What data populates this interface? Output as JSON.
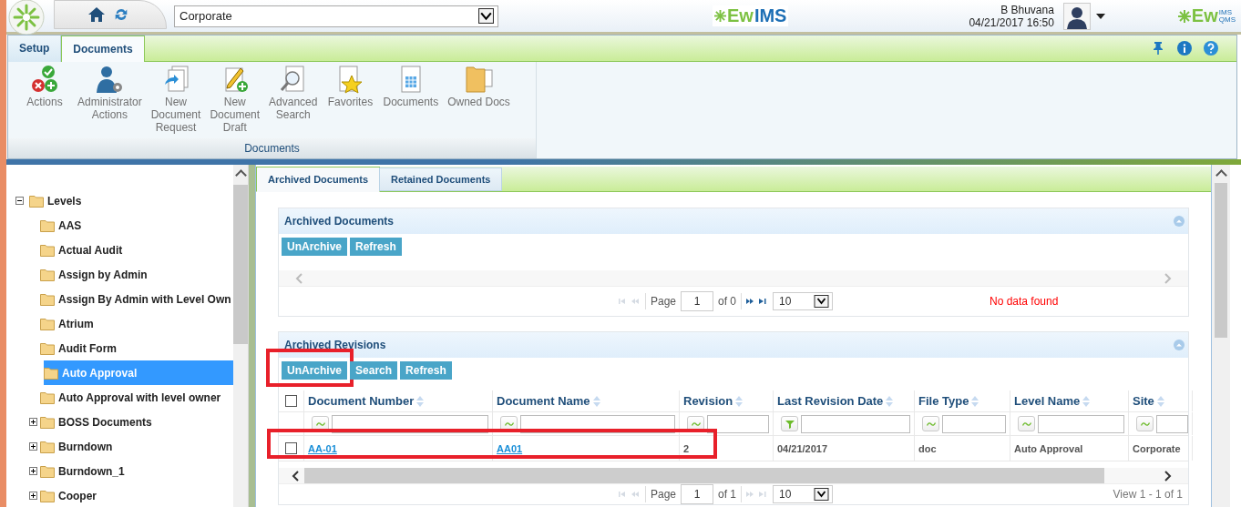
{
  "header": {
    "selector": {
      "value": "Corporate"
    },
    "center_logo": {
      "prefix": "Ew",
      "suffix": "IMS"
    },
    "user": {
      "name": "B Bhuvana",
      "datetime": "04/21/2017 16:50"
    },
    "right_logo": {
      "prefix": "Ew",
      "top": "IMS",
      "bottom": "QMS"
    }
  },
  "ribbon": {
    "tabs": [
      {
        "label": "Setup",
        "selected": false
      },
      {
        "label": "Documents",
        "selected": true
      }
    ],
    "groups": [
      {
        "label": "Documents",
        "items": [
          {
            "kind": "actions",
            "label": "Actions"
          },
          {
            "kind": "admin",
            "label": "Administrator\nActions"
          },
          {
            "kind": "request",
            "label": "New\nDocument\nRequest"
          },
          {
            "kind": "draft",
            "label": "New\nDocument\nDraft"
          },
          {
            "kind": "search",
            "label": "Advanced\nSearch"
          },
          {
            "kind": "favorites",
            "label": "Favorites"
          },
          {
            "kind": "documents",
            "label": "Documents"
          },
          {
            "kind": "owned",
            "label": "Owned Docs"
          }
        ]
      }
    ]
  },
  "tree": {
    "root": {
      "label": "Levels",
      "expanded": true,
      "selected": false,
      "children": [
        {
          "label": "AAS",
          "selected": false
        },
        {
          "label": "Actual Audit",
          "selected": false
        },
        {
          "label": "Assign by Admin",
          "selected": false
        },
        {
          "label": "Assign By Admin with Level Own",
          "selected": false
        },
        {
          "label": "Atrium",
          "selected": false
        },
        {
          "label": "Audit Form",
          "selected": false
        },
        {
          "label": "Auto Approval",
          "selected": true
        },
        {
          "label": "Auto Approval with level owner",
          "selected": false
        },
        {
          "label": "BOSS Documents",
          "selected": false,
          "expanded": false
        },
        {
          "label": "Burndown",
          "selected": false,
          "expanded": false
        },
        {
          "label": "Burndown_1",
          "selected": false,
          "expanded": false
        },
        {
          "label": "Cooper",
          "selected": false,
          "expanded": false
        }
      ]
    }
  },
  "content": {
    "tabs": [
      {
        "label": "Archived Documents",
        "selected": true
      },
      {
        "label": "Retained Documents",
        "selected": false
      }
    ],
    "panels": [
      {
        "title": "Archived Documents",
        "buttons": [
          {
            "label": "UnArchive",
            "highlighted": false
          },
          {
            "label": "Refresh",
            "highlighted": false
          }
        ],
        "pager": {
          "page_label": "Page",
          "page": "1",
          "of": "of 0",
          "page_size": "10",
          "can_prev": false,
          "can_next": true,
          "message": "No data found",
          "kind": "error"
        }
      },
      {
        "title": "Archived Revisions",
        "buttons": [
          {
            "label": "UnArchive",
            "highlighted": true
          },
          {
            "label": "Search",
            "highlighted": false
          },
          {
            "label": "Refresh",
            "highlighted": false
          }
        ],
        "table": {
          "all_selected": false,
          "columns": [
            {
              "label": "Document Number",
              "kind": "text"
            },
            {
              "label": "Document Name",
              "kind": "text"
            },
            {
              "label": "Revision",
              "kind": "text"
            },
            {
              "label": "Last Revision Date",
              "kind": "date"
            },
            {
              "label": "File Type",
              "kind": "text"
            },
            {
              "label": "Level Name",
              "kind": "text"
            },
            {
              "label": "Site",
              "kind": "text"
            }
          ],
          "rows": [
            {
              "selected": false,
              "highlighted": true,
              "cells": [
                {
                  "kind": "link",
                  "text": "AA-01"
                },
                {
                  "kind": "link",
                  "text": "AA01"
                },
                {
                  "kind": "text",
                  "text": "2"
                },
                {
                  "kind": "text",
                  "text": "04/21/2017"
                },
                {
                  "kind": "text",
                  "text": "doc"
                },
                {
                  "kind": "text",
                  "text": "Auto Approval"
                },
                {
                  "kind": "text",
                  "text": "Corporate"
                }
              ]
            }
          ]
        },
        "pager": {
          "page_label": "Page",
          "page": "1",
          "of": "of 1",
          "page_size": "10",
          "can_prev": false,
          "can_next": false,
          "message": "View 1 - 1 of 1",
          "kind": "info"
        }
      }
    ]
  }
}
